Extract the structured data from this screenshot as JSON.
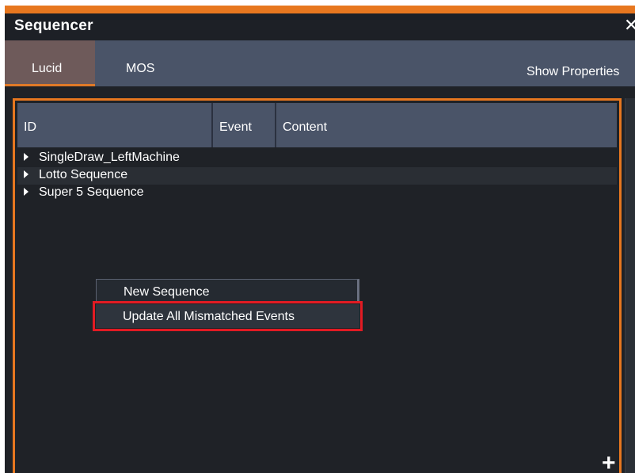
{
  "window": {
    "title": "Sequencer",
    "close_icon": "close-icon",
    "accent_color": "#e7771f"
  },
  "tabs": [
    {
      "label": "Lucid",
      "active": true
    },
    {
      "label": "MOS",
      "active": false
    }
  ],
  "toolbar": {
    "show_properties_label": "Show Properties"
  },
  "table": {
    "columns": [
      "ID",
      "Event",
      "Content"
    ],
    "rows": [
      {
        "label": "SingleDraw_LeftMachine",
        "icon": "expand-arrow-icon"
      },
      {
        "label": "Lotto Sequence",
        "icon": "expand-arrow-icon"
      },
      {
        "label": "Super 5 Sequence",
        "icon": "expand-arrow-icon"
      }
    ]
  },
  "context_menu": {
    "items": [
      {
        "label": "New Sequence"
      },
      {
        "label": "Update All Mismatched Events",
        "highlighted": true,
        "highlight_color": "#e21b23"
      }
    ]
  },
  "add_icon": "plus-icon"
}
